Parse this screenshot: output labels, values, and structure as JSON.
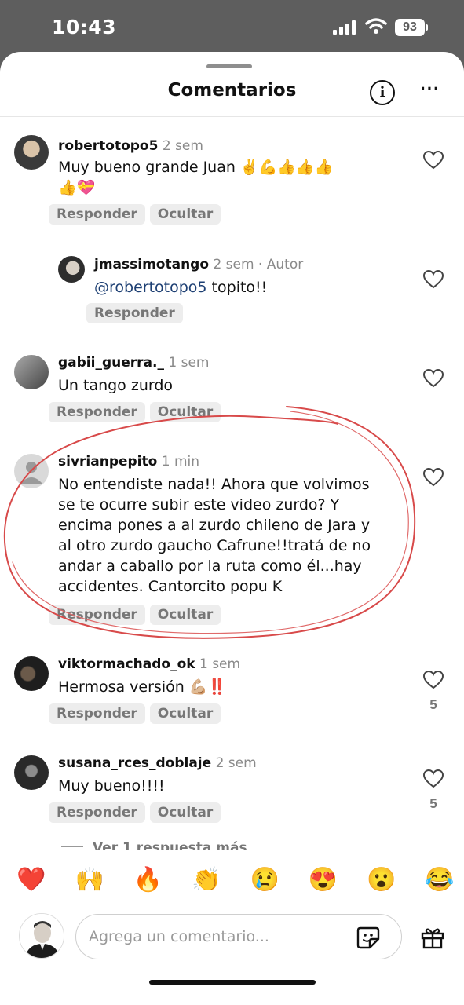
{
  "status_bar": {
    "time": "10:43",
    "battery": "93"
  },
  "header": {
    "title": "Comentarios"
  },
  "comments": [
    {
      "user": "robertotopo5",
      "when": "2 sem",
      "text_line1": "Muy bueno grande  Juan ✌️💪👍👍👍",
      "text_line2": "👍💝",
      "reply": "Responder",
      "hide": "Ocultar"
    },
    {
      "user": "jmassimotango",
      "when": "2 sem · Autor",
      "mention": "@robertotopo5",
      "text": " topito!!",
      "reply": "Responder"
    },
    {
      "user": "gabii_guerra._",
      "when": "1 sem",
      "text": "Un tango zurdo",
      "reply": "Responder",
      "hide": "Ocultar"
    },
    {
      "user": "sivrianpepito",
      "when": "1 min",
      "lines": [
        "No entendiste nada!! Ahora que volvimos",
        "se te ocurre subir este video zurdo? Y",
        "encima pones a al zurdo chileno de Jara y",
        "al otro zurdo gaucho Cafrune!!tratá de no",
        "andar a caballo por la ruta como él...hay",
        "accidentes. Cantorcito popu K"
      ],
      "reply": "Responder",
      "hide": "Ocultar"
    },
    {
      "user": "viktormachado_ok",
      "when": "1 sem",
      "text": "Hermosa versión 💪🏼‼️",
      "reply": "Responder",
      "hide": "Ocultar",
      "likes": "5"
    },
    {
      "user": "susana_rces_doblaje",
      "when": "2 sem",
      "text": "Muy bueno!!!!",
      "reply": "Responder",
      "hide": "Ocultar",
      "likes": "5"
    }
  ],
  "view_more": "Ver 1 respuesta más",
  "reactions": [
    "❤️",
    "🙌",
    "🔥",
    "👏",
    "😢",
    "😍",
    "😮",
    "😂"
  ],
  "composer": {
    "placeholder": "Agrega un comentario..."
  },
  "icons": [
    "info-icon",
    "more-icon",
    "heart-icon",
    "sticker-icon",
    "gift-icon"
  ]
}
